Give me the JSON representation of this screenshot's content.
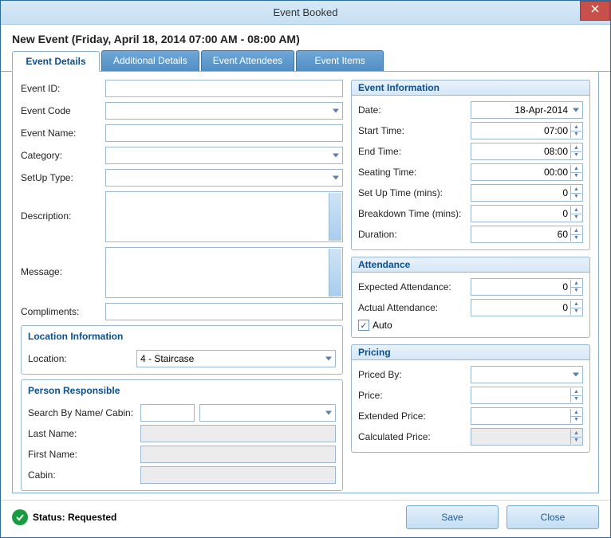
{
  "window": {
    "title": "Event Booked"
  },
  "header": {
    "text": "New Event (Friday, April 18, 2014  07:00 AM - 08:00 AM)"
  },
  "tabs": [
    {
      "label": "Event Details",
      "active": true
    },
    {
      "label": "Additional Details",
      "active": false
    },
    {
      "label": "Event Attendees",
      "active": false
    },
    {
      "label": "Event Items",
      "active": false
    }
  ],
  "left": {
    "event_id_label": "Event ID:",
    "event_id": "",
    "event_code_label": "Event Code",
    "event_code": "",
    "event_name_label": "Event Name:",
    "event_name": "",
    "category_label": "Category:",
    "category": "",
    "setup_type_label": "SetUp Type:",
    "setup_type": "",
    "description_label": "Description:",
    "description": "",
    "message_label": "Message:",
    "message": "",
    "compliments_label": "Compliments:",
    "compliments": "",
    "location_group_title": "Location Information",
    "location_label": "Location:",
    "location": "4 - Staircase",
    "person_group_title": "Person Responsible",
    "search_label": "Search By Name/ Cabin:",
    "search_text": "",
    "search_combo": "",
    "last_name_label": "Last Name:",
    "last_name": "",
    "first_name_label": "First Name:",
    "first_name": "",
    "cabin_label": "Cabin:",
    "cabin": ""
  },
  "right": {
    "event_info_title": "Event Information",
    "date_label": "Date:",
    "date": "18-Apr-2014",
    "start_time_label": "Start Time:",
    "start_time": "07:00",
    "end_time_label": "End Time:",
    "end_time": "08:00",
    "seating_time_label": "Seating Time:",
    "seating_time": "00:00",
    "setup_time_label": "Set Up Time (mins):",
    "setup_time": "0",
    "breakdown_time_label": "Breakdown Time (mins):",
    "breakdown_time": "0",
    "duration_label": "Duration:",
    "duration": "60",
    "attendance_title": "Attendance",
    "expected_label": "Expected Attendance:",
    "expected": "0",
    "actual_label": "Actual Attendance:",
    "actual": "0",
    "auto_label": "Auto",
    "auto_checked": true,
    "pricing_title": "Pricing",
    "priced_by_label": "Priced By:",
    "priced_by": "",
    "price_label": "Price:",
    "price": "",
    "extended_label": "Extended Price:",
    "extended": "",
    "calculated_label": "Calculated Price:",
    "calculated": ""
  },
  "footer": {
    "status_label": "Status:  Requested",
    "save_label": "Save",
    "close_label": "Close"
  }
}
